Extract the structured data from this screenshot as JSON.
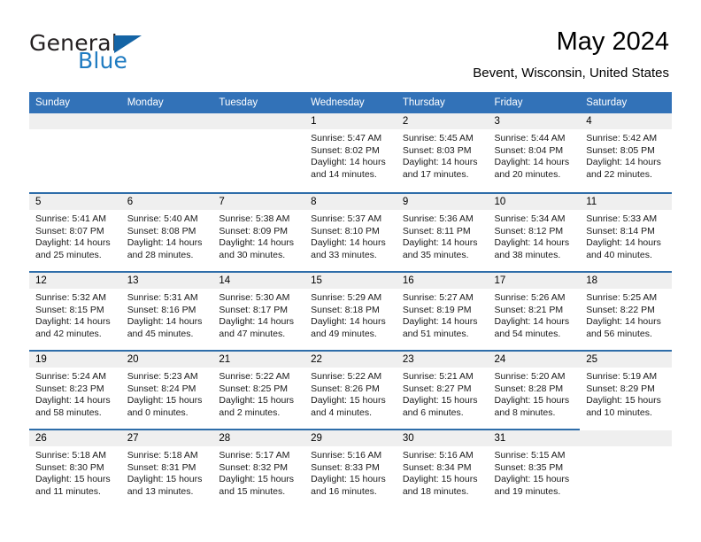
{
  "branding": {
    "name_part1": "General",
    "name_part2": "Blue",
    "triangle_icon": "triangle-icon"
  },
  "header": {
    "month_title": "May 2024",
    "location": "Bevent, Wisconsin, United States"
  },
  "colors": {
    "header_blue": "#3272b8",
    "row_divider_blue": "#2e6da9",
    "daynum_band": "#efefef",
    "logo_blue": "#1f7bc1",
    "logo_dark": "#231f20"
  },
  "weekday_headers": [
    "Sunday",
    "Monday",
    "Tuesday",
    "Wednesday",
    "Thursday",
    "Friday",
    "Saturday"
  ],
  "weeks": [
    [
      {
        "day": "",
        "details": "",
        "empty": true
      },
      {
        "day": "",
        "details": "",
        "empty": true
      },
      {
        "day": "",
        "details": "",
        "empty": true
      },
      {
        "day": "1",
        "details": "Sunrise: 5:47 AM\nSunset: 8:02 PM\nDaylight: 14 hours\nand 14 minutes."
      },
      {
        "day": "2",
        "details": "Sunrise: 5:45 AM\nSunset: 8:03 PM\nDaylight: 14 hours\nand 17 minutes."
      },
      {
        "day": "3",
        "details": "Sunrise: 5:44 AM\nSunset: 8:04 PM\nDaylight: 14 hours\nand 20 minutes."
      },
      {
        "day": "4",
        "details": "Sunrise: 5:42 AM\nSunset: 8:05 PM\nDaylight: 14 hours\nand 22 minutes."
      }
    ],
    [
      {
        "day": "5",
        "details": "Sunrise: 5:41 AM\nSunset: 8:07 PM\nDaylight: 14 hours\nand 25 minutes."
      },
      {
        "day": "6",
        "details": "Sunrise: 5:40 AM\nSunset: 8:08 PM\nDaylight: 14 hours\nand 28 minutes."
      },
      {
        "day": "7",
        "details": "Sunrise: 5:38 AM\nSunset: 8:09 PM\nDaylight: 14 hours\nand 30 minutes."
      },
      {
        "day": "8",
        "details": "Sunrise: 5:37 AM\nSunset: 8:10 PM\nDaylight: 14 hours\nand 33 minutes."
      },
      {
        "day": "9",
        "details": "Sunrise: 5:36 AM\nSunset: 8:11 PM\nDaylight: 14 hours\nand 35 minutes."
      },
      {
        "day": "10",
        "details": "Sunrise: 5:34 AM\nSunset: 8:12 PM\nDaylight: 14 hours\nand 38 minutes."
      },
      {
        "day": "11",
        "details": "Sunrise: 5:33 AM\nSunset: 8:14 PM\nDaylight: 14 hours\nand 40 minutes."
      }
    ],
    [
      {
        "day": "12",
        "details": "Sunrise: 5:32 AM\nSunset: 8:15 PM\nDaylight: 14 hours\nand 42 minutes."
      },
      {
        "day": "13",
        "details": "Sunrise: 5:31 AM\nSunset: 8:16 PM\nDaylight: 14 hours\nand 45 minutes."
      },
      {
        "day": "14",
        "details": "Sunrise: 5:30 AM\nSunset: 8:17 PM\nDaylight: 14 hours\nand 47 minutes."
      },
      {
        "day": "15",
        "details": "Sunrise: 5:29 AM\nSunset: 8:18 PM\nDaylight: 14 hours\nand 49 minutes."
      },
      {
        "day": "16",
        "details": "Sunrise: 5:27 AM\nSunset: 8:19 PM\nDaylight: 14 hours\nand 51 minutes."
      },
      {
        "day": "17",
        "details": "Sunrise: 5:26 AM\nSunset: 8:21 PM\nDaylight: 14 hours\nand 54 minutes."
      },
      {
        "day": "18",
        "details": "Sunrise: 5:25 AM\nSunset: 8:22 PM\nDaylight: 14 hours\nand 56 minutes."
      }
    ],
    [
      {
        "day": "19",
        "details": "Sunrise: 5:24 AM\nSunset: 8:23 PM\nDaylight: 14 hours\nand 58 minutes."
      },
      {
        "day": "20",
        "details": "Sunrise: 5:23 AM\nSunset: 8:24 PM\nDaylight: 15 hours\nand 0 minutes."
      },
      {
        "day": "21",
        "details": "Sunrise: 5:22 AM\nSunset: 8:25 PM\nDaylight: 15 hours\nand 2 minutes."
      },
      {
        "day": "22",
        "details": "Sunrise: 5:22 AM\nSunset: 8:26 PM\nDaylight: 15 hours\nand 4 minutes."
      },
      {
        "day": "23",
        "details": "Sunrise: 5:21 AM\nSunset: 8:27 PM\nDaylight: 15 hours\nand 6 minutes."
      },
      {
        "day": "24",
        "details": "Sunrise: 5:20 AM\nSunset: 8:28 PM\nDaylight: 15 hours\nand 8 minutes."
      },
      {
        "day": "25",
        "details": "Sunrise: 5:19 AM\nSunset: 8:29 PM\nDaylight: 15 hours\nand 10 minutes."
      }
    ],
    [
      {
        "day": "26",
        "details": "Sunrise: 5:18 AM\nSunset: 8:30 PM\nDaylight: 15 hours\nand 11 minutes."
      },
      {
        "day": "27",
        "details": "Sunrise: 5:18 AM\nSunset: 8:31 PM\nDaylight: 15 hours\nand 13 minutes."
      },
      {
        "day": "28",
        "details": "Sunrise: 5:17 AM\nSunset: 8:32 PM\nDaylight: 15 hours\nand 15 minutes."
      },
      {
        "day": "29",
        "details": "Sunrise: 5:16 AM\nSunset: 8:33 PM\nDaylight: 15 hours\nand 16 minutes."
      },
      {
        "day": "30",
        "details": "Sunrise: 5:16 AM\nSunset: 8:34 PM\nDaylight: 15 hours\nand 18 minutes."
      },
      {
        "day": "31",
        "details": "Sunrise: 5:15 AM\nSunset: 8:35 PM\nDaylight: 15 hours\nand 19 minutes."
      },
      {
        "day": "",
        "details": "",
        "empty": true
      }
    ]
  ]
}
